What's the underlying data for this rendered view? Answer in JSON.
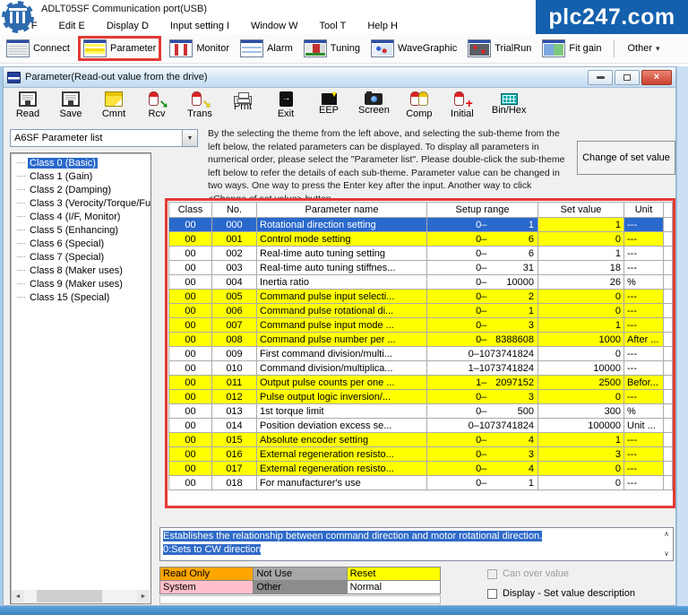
{
  "window": {
    "title": "ADLT05SF  Communication port(USB)"
  },
  "banner": {
    "text": "plc247.com",
    "color": "#1460AE"
  },
  "menu": {
    "items": [
      "File F",
      "Edit E",
      "Display D",
      "Input setting I",
      "Window W",
      "Tool T",
      "Help H"
    ]
  },
  "main_toolbar": {
    "items": [
      {
        "label": "Connect",
        "icon": "connect",
        "icon_name": "connect-icon"
      },
      {
        "label": "Parameter",
        "icon": "parameter",
        "icon_name": "parameter-icon",
        "highlighted": true
      },
      {
        "label": "Monitor",
        "icon": "monitor",
        "icon_name": "monitor-icon"
      },
      {
        "label": "Alarm",
        "icon": "alarm",
        "icon_name": "alarm-icon"
      },
      {
        "label": "Tuning",
        "icon": "tuning",
        "icon_name": "tuning-icon"
      },
      {
        "label": "WaveGraphic",
        "icon": "wavegraphic",
        "icon_name": "wave-graphic-icon"
      },
      {
        "label": "TrialRun",
        "icon": "trialrun",
        "icon_name": "trial-run-icon"
      },
      {
        "label": "Fit gain",
        "icon": "fitgain",
        "icon_name": "fit-gain-icon"
      },
      {
        "separator": true
      },
      {
        "label": "Other",
        "dropdown": true
      }
    ],
    "highlight_color": "#E53935"
  },
  "param_window": {
    "title": "Parameter(Read-out value from the drive)",
    "toolbar": [
      {
        "label": "Read",
        "icon": "floppy",
        "icon_name": "floppy-disk-icon"
      },
      {
        "label": "Save",
        "icon": "floppy",
        "icon_name": "floppy-disk-icon"
      },
      {
        "label": "Cmnt",
        "icon": "note",
        "icon_name": "comment-note-icon"
      },
      {
        "label": "Rcv",
        "icon": "cyl ci-rcv",
        "icon_name": "receive-icon"
      },
      {
        "label": "Trans",
        "icon": "cyl ci-trans",
        "icon_name": "transmit-icon"
      },
      {
        "label": "Prnt",
        "icon": "printer",
        "icon_name": "printer-icon"
      },
      {
        "label": "Exit",
        "icon": "exit",
        "icon_name": "exit-icon"
      },
      {
        "label": "EEP",
        "icon": "eep",
        "icon_name": "eeprom-write-icon"
      },
      {
        "label": "Screen",
        "icon": "camera",
        "icon_name": "screen-capture-icon"
      },
      {
        "label": "Comp",
        "icon": "comp",
        "icon_name": "compare-icon"
      },
      {
        "label": "Initial",
        "icon": "initial",
        "icon_name": "initialize-icon"
      },
      {
        "label": "Bin/Hex",
        "icon": "binhex",
        "icon_name": "bin-hex-icon"
      }
    ],
    "list_selector": {
      "value": "A6SF Parameter list"
    },
    "tree": {
      "items": [
        {
          "label": "Class 0 (Basic)",
          "selected": true
        },
        {
          "label": "Class 1 (Gain)"
        },
        {
          "label": "Class 2 (Damping)"
        },
        {
          "label": "Class 3 (Verocity/Torque/Fu"
        },
        {
          "label": "Class 4 (I/F, Monitor)"
        },
        {
          "label": "Class 5 (Enhancing)"
        },
        {
          "label": "Class 6 (Special)"
        },
        {
          "label": "Class 7 (Special)"
        },
        {
          "label": "Class 8 (Maker uses)"
        },
        {
          "label": "Class 9 (Maker uses)"
        },
        {
          "label": "Class 15 (Special)"
        }
      ]
    },
    "instructions": "By the selecting the theme from the left above, and selecting the sub-theme from the left below, the related parameters can be displayed. To display all parameters in numerical order, please select the \"Parameter list\". Please double-click the sub-theme left below to refer the details of each sub-theme. Parameter value can be changed in two ways. One way to press the Enter key after the input. Another way to click <Change of set value> button.",
    "change_button": "Change of set value",
    "table": {
      "headers": [
        "Class",
        "No.",
        "Parameter name",
        "Setup range",
        "Set value",
        "Unit"
      ],
      "rows": [
        {
          "cls": "00",
          "no": "000",
          "name": "Rotational direction setting",
          "min": "0–",
          "max": "1",
          "val": "1",
          "unit": "---",
          "style": "sel"
        },
        {
          "cls": "00",
          "no": "001",
          "name": "Control mode setting",
          "min": "0–",
          "max": "6",
          "val": "0",
          "unit": "---",
          "style": "y"
        },
        {
          "cls": "00",
          "no": "002",
          "name": "Real-time auto tuning setting",
          "min": "0–",
          "max": "6",
          "val": "1",
          "unit": "---",
          "style": "w"
        },
        {
          "cls": "00",
          "no": "003",
          "name": "Real-time auto tuning stiffnes...",
          "min": "0–",
          "max": "31",
          "val": "18",
          "unit": "---",
          "style": "w"
        },
        {
          "cls": "00",
          "no": "004",
          "name": "Inertia ratio",
          "min": "0–",
          "max": "10000",
          "val": "26",
          "unit": "%",
          "style": "w"
        },
        {
          "cls": "00",
          "no": "005",
          "name": "Command pulse input selecti...",
          "min": "0–",
          "max": "2",
          "val": "0",
          "unit": "---",
          "style": "y"
        },
        {
          "cls": "00",
          "no": "006",
          "name": "Command pulse rotational di...",
          "min": "0–",
          "max": "1",
          "val": "0",
          "unit": "---",
          "style": "y"
        },
        {
          "cls": "00",
          "no": "007",
          "name": "Command pulse input mode ...",
          "min": "0–",
          "max": "3",
          "val": "1",
          "unit": "---",
          "style": "y"
        },
        {
          "cls": "00",
          "no": "008",
          "name": "Command pulse number per ...",
          "min": "0–",
          "max": "8388608",
          "val": "1000",
          "unit": "After ...",
          "style": "y"
        },
        {
          "cls": "00",
          "no": "009",
          "name": "First command division/multi...",
          "min": "0–",
          "max": "1073741824",
          "val": "0",
          "unit": "---",
          "style": "w"
        },
        {
          "cls": "00",
          "no": "010",
          "name": "Command division/multiplica...",
          "min": "1–",
          "max": "1073741824",
          "val": "10000",
          "unit": "---",
          "style": "w"
        },
        {
          "cls": "00",
          "no": "011",
          "name": "Output pulse counts per one ...",
          "min": "1–",
          "max": "2097152",
          "val": "2500",
          "unit": "Befor...",
          "style": "y"
        },
        {
          "cls": "00",
          "no": "012",
          "name": "Pulse output logic inversion/...",
          "min": "0–",
          "max": "3",
          "val": "0",
          "unit": "---",
          "style": "y"
        },
        {
          "cls": "00",
          "no": "013",
          "name": "1st torque limit",
          "min": "0–",
          "max": "500",
          "val": "300",
          "unit": "%",
          "style": "w"
        },
        {
          "cls": "00",
          "no": "014",
          "name": "Position deviation excess se...",
          "min": "0–",
          "max": "1073741824",
          "val": "100000",
          "unit": "Unit ...",
          "style": "w"
        },
        {
          "cls": "00",
          "no": "015",
          "name": "Absolute encoder setting",
          "min": "0–",
          "max": "4",
          "val": "1",
          "unit": "---",
          "style": "y"
        },
        {
          "cls": "00",
          "no": "016",
          "name": "External regeneration resisto...",
          "min": "0–",
          "max": "3",
          "val": "3",
          "unit": "---",
          "style": "y"
        },
        {
          "cls": "00",
          "no": "017",
          "name": "External regeneration resisto...",
          "min": "0–",
          "max": "4",
          "val": "0",
          "unit": "---",
          "style": "y"
        },
        {
          "cls": "00",
          "no": "018",
          "name": "For manufacturer's use",
          "min": "0–",
          "max": "1",
          "val": "0",
          "unit": "---",
          "style": "w"
        }
      ],
      "selected_row_color": "#2A69CC",
      "changed_row_color": "#FFFF00",
      "highlight_border_color": "#E53935"
    },
    "description": {
      "lines": [
        "Establishes the relationship between command direction and motor rotational direction.",
        "0:Sets to CW direction"
      ]
    },
    "legend": {
      "rows": [
        [
          {
            "label": "Read Only",
            "color": "#FFA500"
          },
          {
            "label": "Not Use",
            "color": "#A8A8A8"
          },
          {
            "label": "Reset",
            "color": "#FFFF00"
          }
        ],
        [
          {
            "label": "System",
            "color": "#FFC0CB"
          },
          {
            "label": "Other",
            "color": "#8C8C8C"
          },
          {
            "label": "Normal",
            "color": "#FFFFFF"
          }
        ]
      ]
    },
    "checkboxes": [
      {
        "label": "Can over value",
        "disabled": true,
        "checked": false
      },
      {
        "label": "Display - Set value description",
        "disabled": false,
        "checked": false
      }
    ]
  }
}
